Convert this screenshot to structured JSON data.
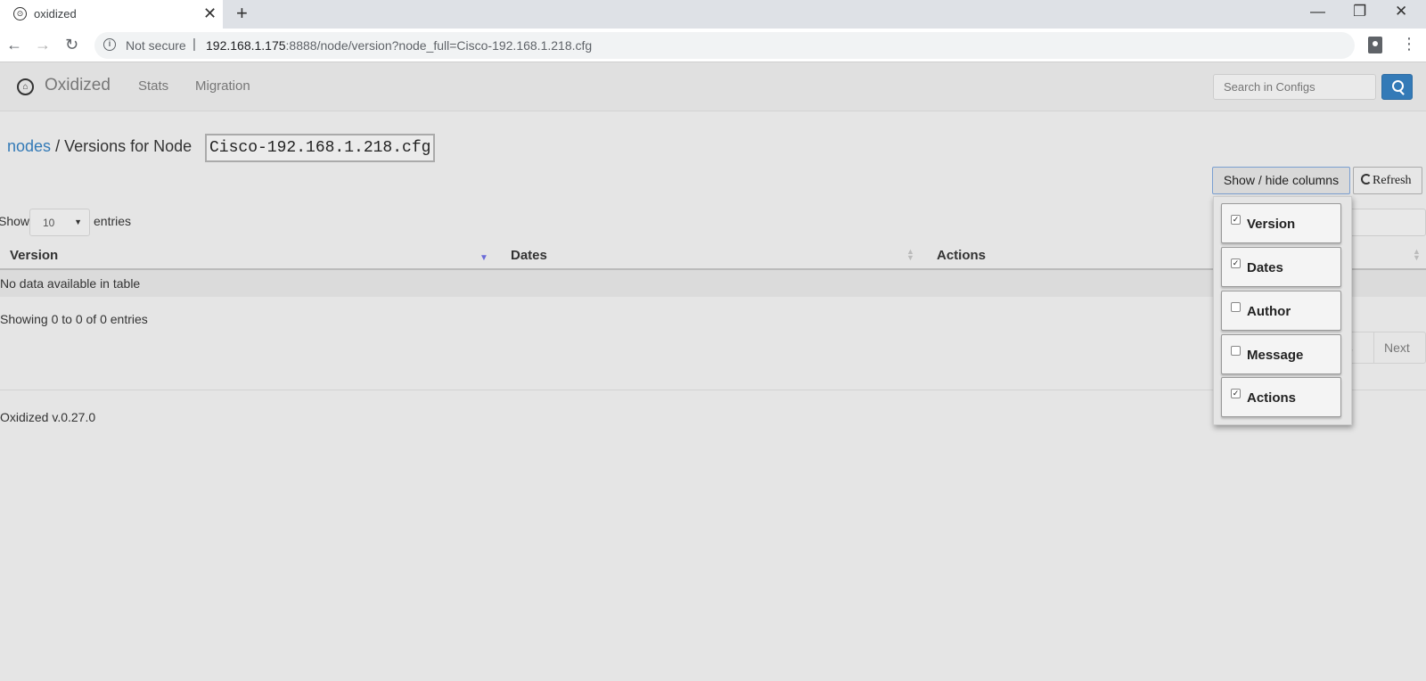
{
  "browser": {
    "tab_title": "oxidized",
    "tab_close": "✕",
    "new_tab": "+",
    "window": {
      "minimize": "—",
      "restore": "❐",
      "close": "✕"
    },
    "nav": {
      "back": "←",
      "forward": "→",
      "reload": "↻"
    },
    "security_label": "Not secure",
    "separator": "|",
    "url_host": "192.168.1.175",
    "url_path": ":8888/node/version?node_full=Cisco-192.168.1.218.cfg",
    "menu": "⋮"
  },
  "navbar": {
    "brand": "Oxidized",
    "links": [
      "Stats",
      "Migration"
    ],
    "search_placeholder": "Search in Configs"
  },
  "breadcrumb": {
    "link": "nodes",
    "text": "/ Versions for Node",
    "node": "Cisco-192.168.1.218.cfg"
  },
  "buttons": {
    "colvis": "Show / hide columns",
    "refresh": "Refresh"
  },
  "table": {
    "length_prefix": "Show",
    "length_value": "10",
    "length_suffix": "entries",
    "headers": [
      "Version",
      "Dates",
      "Actions"
    ],
    "empty": "No data available in table",
    "info": "Showing 0 to 0 of 0 entries",
    "pager": {
      "previous": "us",
      "next": "Next"
    }
  },
  "colvis_menu": [
    {
      "label": "Version",
      "checked": true
    },
    {
      "label": "Dates",
      "checked": true
    },
    {
      "label": "Author",
      "checked": false
    },
    {
      "label": "Message",
      "checked": false
    },
    {
      "label": "Actions",
      "checked": true
    }
  ],
  "footer": "Oxidized v.0.27.0",
  "colors": {
    "accent": "#337ab7",
    "background": "#e5e5e5"
  }
}
